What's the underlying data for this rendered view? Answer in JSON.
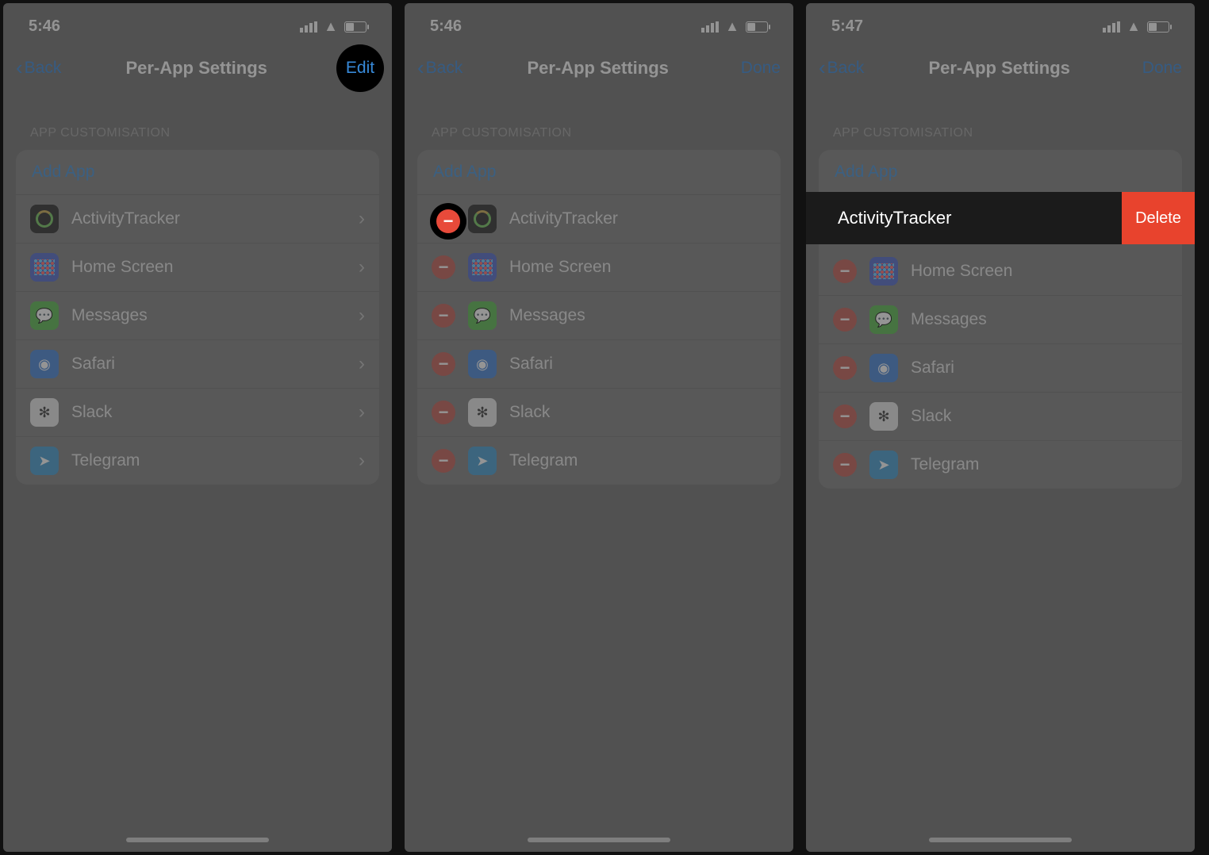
{
  "screens": [
    {
      "time": "5:46",
      "back": "Back",
      "title": "Per-App Settings",
      "action": "Edit",
      "section": "APP CUSTOMISATION",
      "add": "Add App",
      "mode": "view",
      "items": [
        "ActivityTracker",
        "Home Screen",
        "Messages",
        "Safari",
        "Slack",
        "Telegram"
      ]
    },
    {
      "time": "5:46",
      "back": "Back",
      "title": "Per-App Settings",
      "action": "Done",
      "section": "APP CUSTOMISATION",
      "add": "Add App",
      "mode": "edit",
      "items": [
        "ActivityTracker",
        "Home Screen",
        "Messages",
        "Safari",
        "Slack",
        "Telegram"
      ]
    },
    {
      "time": "5:47",
      "back": "Back",
      "title": "Per-App Settings",
      "action": "Done",
      "section": "APP CUSTOMISATION",
      "add": "Add App",
      "mode": "swipe",
      "swipe_label": "ActivityTracker",
      "delete": "Delete",
      "items": [
        "Home Screen",
        "Messages",
        "Safari",
        "Slack",
        "Telegram"
      ]
    }
  ],
  "icon_map": {
    "ActivityTracker": "activity",
    "Home Screen": "home",
    "Messages": "messages",
    "Safari": "safari",
    "Slack": "slack",
    "Telegram": "telegram"
  }
}
